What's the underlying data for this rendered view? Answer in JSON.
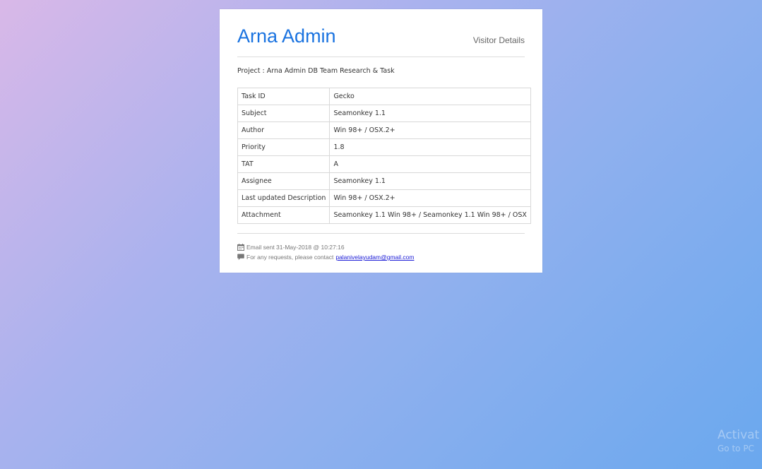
{
  "header": {
    "brand": "Arna Admin",
    "right_title": "Visitor Details"
  },
  "project": {
    "text": "Project : Arna Admin DB Team Research & Task"
  },
  "details": {
    "rows": [
      {
        "label": "Task ID",
        "value": "Gecko"
      },
      {
        "label": "Subject",
        "value": "Seamonkey 1.1"
      },
      {
        "label": "Author",
        "value": "Win 98+ / OSX.2+"
      },
      {
        "label": "Priority",
        "value": "1.8"
      },
      {
        "label": "TAT",
        "value": "A"
      },
      {
        "label": "Assignee",
        "value": "Seamonkey 1.1"
      },
      {
        "label": "Last updated Description",
        "value": "Win 98+ / OSX.2+"
      },
      {
        "label": "Attachment",
        "value": "Seamonkey 1.1 Win 98+ / Seamonkey 1.1 Win 98+ / OSX"
      }
    ]
  },
  "footer": {
    "email_sent": "Email sent 31-May-2018 @ 10:27:16",
    "contact_prefix": "For any requests, please contact",
    "contact_email": "palanivelayudam@gmail.com",
    "calendar_icon": "calendar-icon",
    "comment_icon": "comment-icon"
  },
  "watermark": {
    "line1": "Activat",
    "line2": "Go to PC"
  },
  "colors": {
    "brand": "#1a73e0",
    "link": "#1a1ad6",
    "background_start": "#d9b8e8",
    "background_end": "#6aa8ee"
  }
}
